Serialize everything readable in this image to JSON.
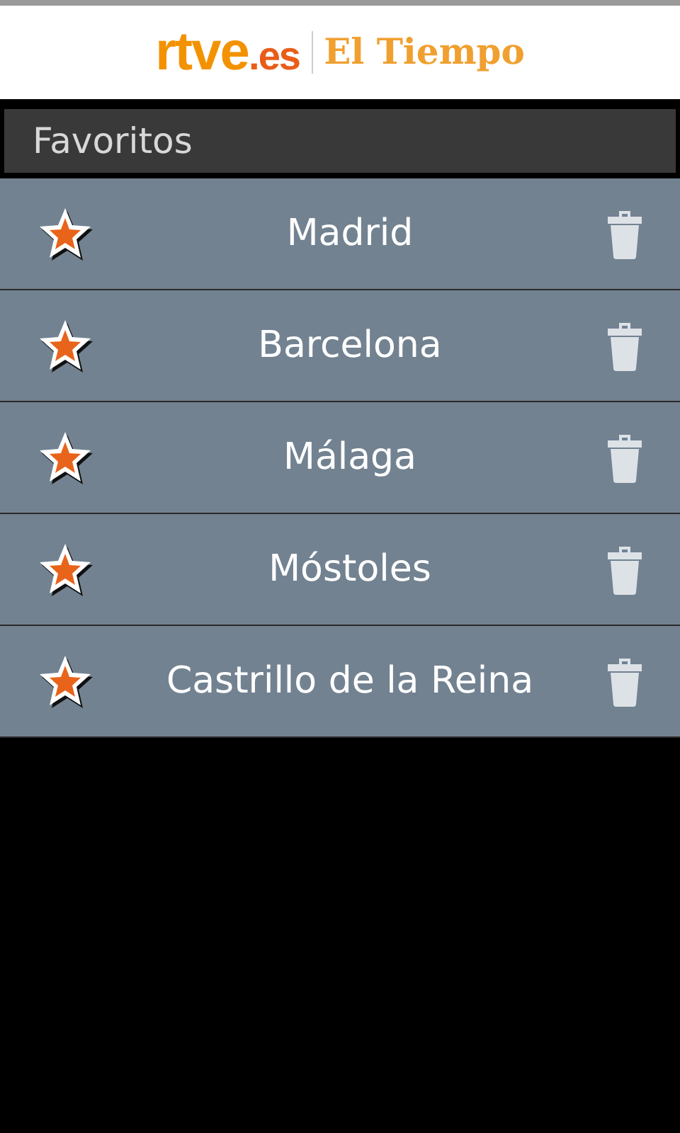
{
  "header": {
    "logo": "rtve",
    "logo_suffix": ".es",
    "title": "El Tiempo"
  },
  "section": {
    "title": "Favoritos"
  },
  "favorites": [
    {
      "name": "Madrid"
    },
    {
      "name": "Barcelona"
    },
    {
      "name": "Málaga"
    },
    {
      "name": "Móstoles"
    },
    {
      "name": "Castrillo de la Reina"
    }
  ]
}
